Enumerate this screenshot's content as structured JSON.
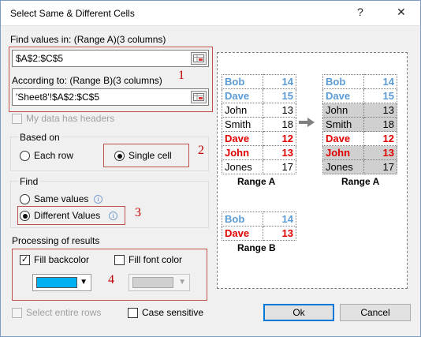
{
  "window": {
    "title": "Select Same & Different Cells",
    "help": "?",
    "close": "✕"
  },
  "find_values": {
    "label": "Find values in: (Range A)(3 columns)",
    "value": "$A$2:$C$5"
  },
  "according": {
    "label": "According to: (Range B)(3 columns)",
    "value": "'Sheet8'!$A$2:$C$5"
  },
  "has_headers": {
    "label": "My data has headers",
    "checked": false,
    "disabled": true
  },
  "based_on": {
    "title": "Based on",
    "options": [
      "Each row",
      "Single cell"
    ],
    "selected": "Single cell"
  },
  "find": {
    "title": "Find",
    "options": [
      "Same values",
      "Different Values"
    ],
    "selected": "Different Values"
  },
  "processing": {
    "title": "Processing of results",
    "fill_backcolor": {
      "label": "Fill backcolor",
      "checked": true,
      "color": "#00b0f0"
    },
    "fill_fontcolor": {
      "label": "Fill font color",
      "checked": false,
      "color": "#d0d0d0"
    }
  },
  "select_entire_rows": {
    "label": "Select entire rows",
    "disabled": true
  },
  "case_sensitive": {
    "label": "Case sensitive",
    "checked": false
  },
  "buttons": {
    "ok": "Ok",
    "cancel": "Cancel"
  },
  "annotations": [
    "1",
    "2",
    "3",
    "4"
  ],
  "preview": {
    "range_a": [
      {
        "name": "Bob",
        "value": "14",
        "style": "blue"
      },
      {
        "name": "Dave",
        "value": "15",
        "style": "blue"
      },
      {
        "name": "John",
        "value": "13",
        "style": "black"
      },
      {
        "name": "Smith",
        "value": "18",
        "style": "black"
      },
      {
        "name": "Dave",
        "value": "12",
        "style": "red"
      },
      {
        "name": "John",
        "value": "13",
        "style": "red"
      },
      {
        "name": "Jones",
        "value": "17",
        "style": "black"
      }
    ],
    "range_a_result_shaded": [
      false,
      false,
      true,
      true,
      false,
      true,
      true
    ],
    "range_b": [
      {
        "name": "Bob",
        "value": "14",
        "style": "blue"
      },
      {
        "name": "Dave",
        "value": "13",
        "style": "red"
      }
    ],
    "caption_a": "Range A",
    "caption_a_result": "Range A",
    "caption_b": "Range B"
  },
  "colors": {
    "highlight_red": "#c0504d",
    "text_blue": "#5b9bd5",
    "text_red": "#e00000",
    "selection_fill": "#00b0f0",
    "accent": "#0078d7"
  }
}
